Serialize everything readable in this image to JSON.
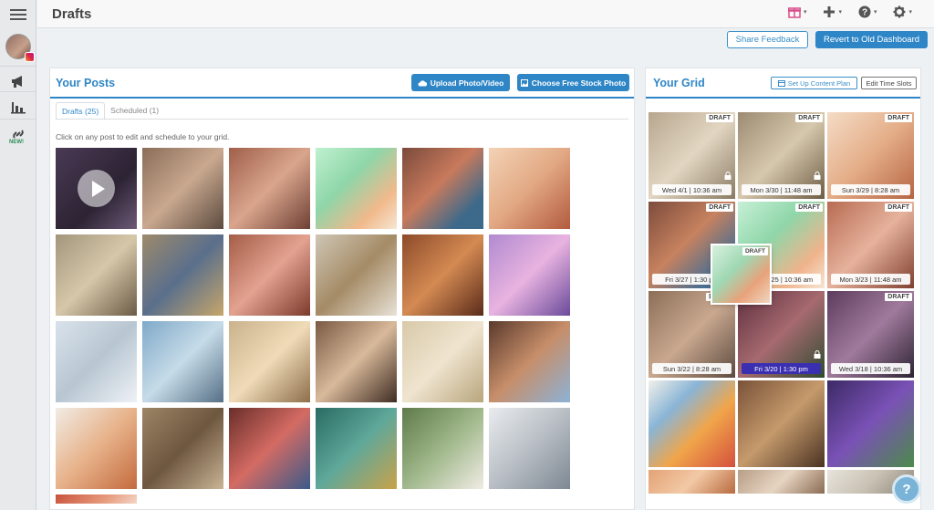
{
  "page": {
    "title": "Drafts"
  },
  "topbar": {
    "icons": [
      {
        "name": "gift-icon",
        "glyph": "🎁",
        "color": "#d94f8a"
      },
      {
        "name": "plus-icon",
        "glyph": "✚",
        "color": "#555555"
      },
      {
        "name": "help-circle-icon",
        "glyph": "❓",
        "color": "#555555"
      },
      {
        "name": "gear-icon",
        "glyph": "⚙",
        "color": "#555555"
      }
    ],
    "caret": "▾"
  },
  "header_actions": {
    "share_feedback": "Share Feedback",
    "revert_dashboard": "Revert to Old Dashboard"
  },
  "sidebar": {
    "new_badge": "NEW!",
    "items": [
      {
        "name": "megaphone-icon",
        "glyph": "📣"
      },
      {
        "name": "bar-chart-icon",
        "glyph": "▮"
      },
      {
        "name": "link-icon",
        "glyph": "🔗"
      }
    ]
  },
  "posts": {
    "title": "Your Posts",
    "upload_button": "Upload Photo/Video",
    "stock_button": "Choose Free Stock Photo",
    "tabs": [
      "Drafts (25)",
      "Scheduled (1)"
    ],
    "hint": "Click on any post to edit and schedule to your grid."
  },
  "grid": {
    "title": "Your Grid",
    "setup_plan": "Set Up Content Plan",
    "edit_slots": "Edit Time Slots",
    "draft_label": "DRAFT",
    "tiles": [
      {
        "date": "Wed 4/1 | 10:36 am",
        "draft": true,
        "locked": true,
        "scheduled": false
      },
      {
        "date": "Mon 3/30 | 11:48 am",
        "draft": true,
        "locked": true,
        "scheduled": false
      },
      {
        "date": "Sun 3/29 | 8:28 am",
        "draft": true,
        "locked": false,
        "scheduled": false
      },
      {
        "date": "Fri 3/27 | 1:30 pm",
        "draft": true,
        "locked": false,
        "scheduled": false
      },
      {
        "date": "Wed 3/25 | 10:36 am",
        "draft": true,
        "locked": false,
        "scheduled": false
      },
      {
        "date": "Mon 3/23 | 11:48 am",
        "draft": true,
        "locked": false,
        "scheduled": false
      },
      {
        "date": "Sun 3/22 | 8:28 am",
        "draft": true,
        "locked": false,
        "scheduled": false
      },
      {
        "date": "Fri 3/20 | 1:30 pm",
        "draft": false,
        "locked": true,
        "scheduled": true
      },
      {
        "date": "Wed 3/18 | 10:36 am",
        "draft": true,
        "locked": false,
        "scheduled": false
      },
      {
        "date": "",
        "draft": false,
        "locked": false,
        "scheduled": false
      },
      {
        "date": "",
        "draft": false,
        "locked": false,
        "scheduled": false
      },
      {
        "date": "",
        "draft": false,
        "locked": false,
        "scheduled": false
      },
      {
        "date": "",
        "draft": false,
        "locked": false,
        "scheduled": false
      },
      {
        "date": "",
        "draft": false,
        "locked": false,
        "scheduled": false
      },
      {
        "date": "",
        "draft": false,
        "locked": false,
        "scheduled": false
      }
    ]
  },
  "help_button": "?"
}
